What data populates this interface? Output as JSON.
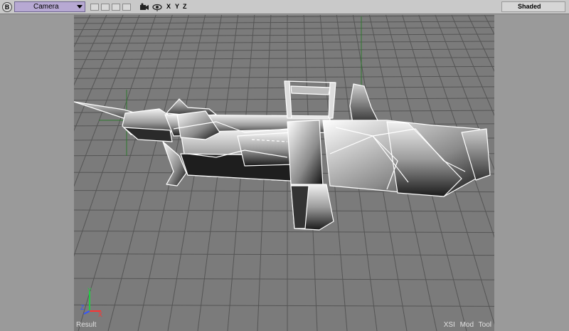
{
  "toolbar": {
    "menu_button_label": "B",
    "camera_label": "Camera",
    "axis_x": "X",
    "axis_y": "Y",
    "axis_z": "Z",
    "shaded_label": "Shaded",
    "icons": [
      "camera-icon",
      "eye-icon"
    ]
  },
  "viewport": {
    "result_label": "Result",
    "tool_label": "XSI Mod Tool"
  },
  "colors": {
    "camera_bg": "#b7a9d3",
    "viewport_bg": "#7b7b7b",
    "grid_line": "#555555",
    "axis_x": "#ff3333",
    "axis_y": "#22cc44",
    "axis_z": "#3355ff"
  }
}
